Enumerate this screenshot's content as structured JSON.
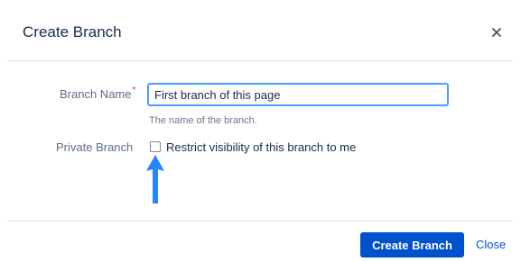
{
  "dialog": {
    "title": "Create Branch",
    "close_icon": "close-icon"
  },
  "form": {
    "branch_name": {
      "label": "Branch Name",
      "required_marker": "*",
      "value": "First branch of this page",
      "helper": "The name of the branch."
    },
    "private_branch": {
      "label": "Private Branch",
      "checkbox_label": "Restrict visibility of this branch to me",
      "checked": false
    }
  },
  "annotation": {
    "icon": "arrow-up-icon",
    "color": "#2684ff"
  },
  "footer": {
    "create_label": "Create Branch",
    "close_label": "Close"
  },
  "colors": {
    "primary": "#0052cc",
    "focus_border": "#4c9aff",
    "required": "#de350b",
    "divider": "#dfe1e6"
  }
}
